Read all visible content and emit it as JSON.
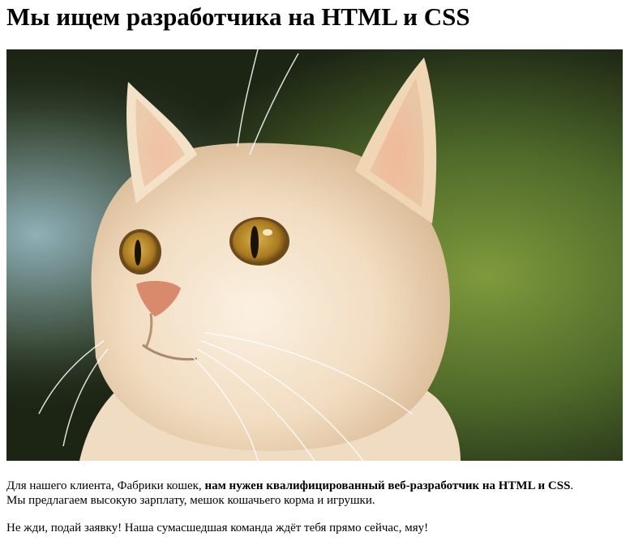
{
  "heading": "Мы ищем разработчика на HTML и CSS",
  "photo": {
    "subject": "cream-colored-cat"
  },
  "paragraph1": {
    "before": "Для нашего клиента, Фабрики кошек, ",
    "bold": "нам нужен квалифицированный веб-разработчик на HTML и CSS",
    "after": ".",
    "line2": "Мы предлагаем высокую зарплату, мешок кошачьего корма и игрушки."
  },
  "paragraph2": "Не жди, подай заявку! Наша сумасшедшая команда ждёт тебя прямо сейчас, мяу!"
}
